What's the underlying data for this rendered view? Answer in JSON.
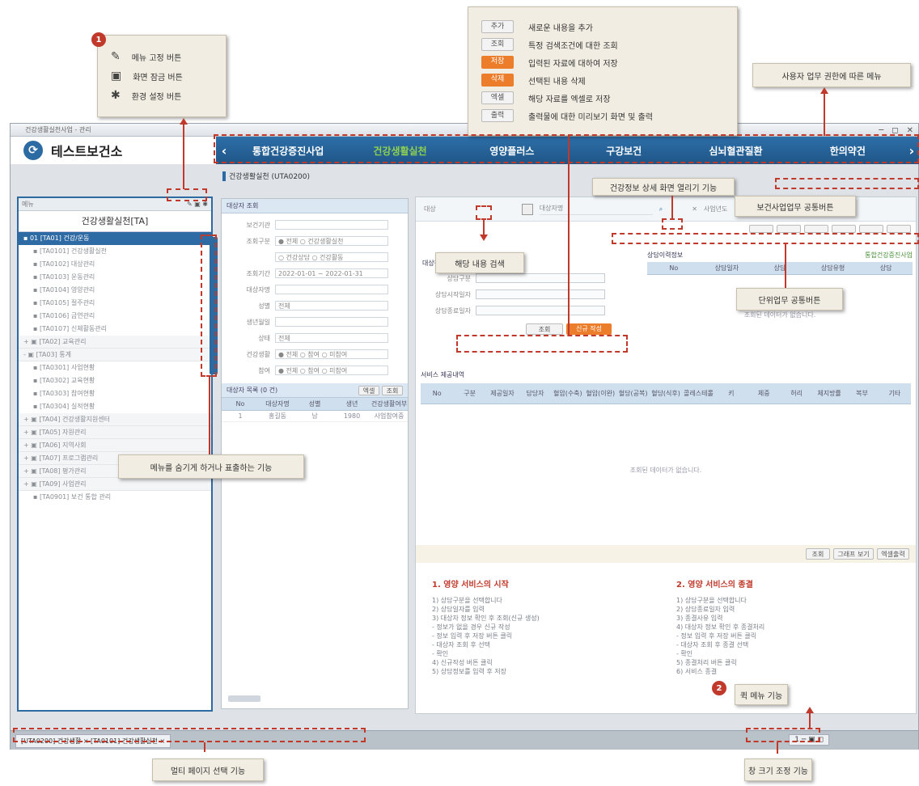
{
  "app": {
    "window_title": "건강생활실천사업 - 관리",
    "org_name": "테스트보건소",
    "nav": {
      "prev": "‹",
      "next": "›",
      "items": [
        "통합건강증진사업",
        "건강생활실천",
        "영양플러스",
        "구강보건",
        "심뇌혈관질환",
        "한의약건"
      ]
    },
    "sidebar": {
      "top_label": "메뉴",
      "title": "건강생활실천[TA]",
      "selected": "▪ 01 [TA01] 건강/운동",
      "items": [
        {
          "label": "▪ [TA0101] 건강생활실천",
          "folder": false
        },
        {
          "label": "▪ [TA0102] 대상관리",
          "folder": false
        },
        {
          "label": "▪ [TA0103] 운동관리",
          "folder": false
        },
        {
          "label": "▪ [TA0104] 영양관리",
          "folder": false
        },
        {
          "label": "▪ [TA0105] 절주관리",
          "folder": false
        },
        {
          "label": "▪ [TA0106] 금연관리",
          "folder": false
        },
        {
          "label": "▪ [TA0107] 신체활동관리",
          "folder": false
        },
        {
          "label": "+ ▣ [TA02] 교육관리",
          "folder": true
        },
        {
          "label": "- ▣ [TA03] 통계",
          "folder": true
        },
        {
          "label": "▪ [TA0301] 사업현황",
          "folder": false
        },
        {
          "label": "▪ [TA0302] 교육현황",
          "folder": false
        },
        {
          "label": "▪ [TA0303] 참여현황",
          "folder": false
        },
        {
          "label": "▪ [TA0304] 실적현황",
          "folder": false
        },
        {
          "label": "+ ▣ [TA04] 건강생활지원센터",
          "folder": true
        },
        {
          "label": "+ ▣ [TA05] 자원관리",
          "folder": true
        },
        {
          "label": "+ ▣ [TA06] 지역사회",
          "folder": true
        },
        {
          "label": "+ ▣ [TA07] 프로그램관리",
          "folder": true
        },
        {
          "label": "+ ▣ [TA08] 평가관리",
          "folder": true
        },
        {
          "label": "+ ▣ [TA09] 사업관리",
          "folder": true
        },
        {
          "label": "▪ [TA0901] 보건 통합 관리",
          "folder": false
        }
      ]
    },
    "breadcrumb": "건강생활실천 (UTA0200)",
    "left_form": {
      "title": "대상자 조회",
      "rows": [
        {
          "label": "보건기관",
          "value": ""
        },
        {
          "label": "조회구분",
          "value": "● 전체   ○ 건강생활실천"
        },
        {
          "label": "",
          "value": "○ 건강상담   ○ 건강활동"
        },
        {
          "label": "조회기간",
          "value": "2022-01-01 ~ 2022-01-31"
        },
        {
          "label": "대상자명",
          "value": ""
        },
        {
          "label": "성별",
          "value": "전체"
        },
        {
          "label": "생년월일",
          "value": ""
        },
        {
          "label": "상태",
          "value": "전체"
        },
        {
          "label": "건강생활",
          "value": "● 전체  ○ 참여  ○ 미참여"
        },
        {
          "label": "참여",
          "value": "● 전체  ○ 참여  ○ 미참여"
        }
      ],
      "list_title": "대상자 목록 (0 건)",
      "btn1": "엑셀",
      "btn2": "조회",
      "list_cols": [
        "No",
        "대상자명",
        "성별",
        "생년",
        "건강생활여부"
      ],
      "list_row": [
        "1",
        "홍길동",
        "남",
        "1980",
        "사업참여중"
      ]
    },
    "right": {
      "search_label": "대상",
      "search_placeholder": "대상자명",
      "search_label2": "사업년도",
      "search_btn": "조회",
      "section1": "대상정보",
      "fields": [
        "상담구분",
        "상담시작일자",
        "상담종료일자"
      ],
      "btn_search": "조회",
      "btn_new": "신규 작성",
      "section2": "상담이력정보",
      "grid2_cols": [
        "No",
        "상담일자",
        "상담",
        "상담유형",
        "상담"
      ],
      "grid2_tag": "통합건강증진사업",
      "empty_text": "조회된 데이터가 없습니다.",
      "section3": "서비스 제공내역",
      "grid3_cols": [
        "No",
        "구분",
        "제공일자",
        "담당자",
        "혈압(수축)",
        "혈압(이완)",
        "혈당(공복)",
        "혈당(식후)",
        "콜레스테롤",
        "키",
        "체중",
        "허리",
        "체지방률",
        "복부",
        "기타"
      ],
      "empty_text2": "조회된 데이터가 없습니다.",
      "bottom_btns": [
        "조회",
        "그래프 보기",
        "엑셀출력"
      ],
      "help1_title": "1. 영양 서비스의 시작",
      "help1_lines": [
        "1) 상담구분을 선택합니다",
        "2) 상담일자를 입력",
        "3) 대상자 정보 확인 후 조회(신규 생성)",
        "   - 정보가 없을 경우 신규 작성",
        "   - 정보 입력 후 저장 버튼 클릭",
        "   - 대상자 조회 후 선택",
        "   - 확인",
        "4) 신규작성 버튼 클릭",
        "5) 상담정보를 입력 후 저장"
      ],
      "help2_title": "2. 영양 서비스의 종결",
      "help2_lines": [
        "1) 상담구분을 선택합니다",
        "2) 상담종료일자 입력",
        "3) 종결사유 입력",
        "4) 대상자 정보 확인 후 종결처리",
        "   - 정보 입력 후 저장 버튼 클릭",
        "   - 대상자 조회 후 종결 선택",
        "   - 확인",
        "5) 종결처리 버튼 클릭",
        "6) 서비스 종결"
      ]
    },
    "status": {
      "tab_label": "[UTA0200] 건강생활 × [TA0101] 건강생활실천 ×",
      "page_ctrl": "1 ─ ▣ ◻"
    }
  },
  "callouts": {
    "badge1": "1",
    "badge2": "2",
    "menu_fix": "메뉴 고정 버튼",
    "screen_lock": "화면 잠금 버튼",
    "env_setting": "환경 설정 버튼",
    "legend": [
      {
        "btn": "추가",
        "desc": "새로운 내용을 추가",
        "style": "gray"
      },
      {
        "btn": "조회",
        "desc": "특정 검색조건에 대한 조회",
        "style": "gray"
      },
      {
        "btn": "저장",
        "desc": "입력된 자료에 대하여 저장",
        "style": "orange"
      },
      {
        "btn": "삭제",
        "desc": "선택된 내용 삭제",
        "style": "orange"
      },
      {
        "btn": "엑셀",
        "desc": "해당 자료를 엑셀로 저장",
        "style": "gray"
      },
      {
        "btn": "출력",
        "desc": "출력물에 대한 미리보기 화면 및 출력",
        "style": "gray"
      }
    ],
    "user_menu": "사용자 업무 권한에 따른 메뉴",
    "consult_open": "건강정보 상세 화면 열리기 기능",
    "common_btn": "보건사업업무 공통버튼",
    "content_search": "해당 내용 검색",
    "biz_common_btn": "단위업무 공통버튼",
    "menu_slide": "메뉴를 숨기게 하거나 표출하는 기능",
    "multi_page": "멀티 페이지 선택 기능",
    "quick_menu": "퀵 메뉴 기능",
    "window_resize": "창 크기 조정 기능"
  }
}
